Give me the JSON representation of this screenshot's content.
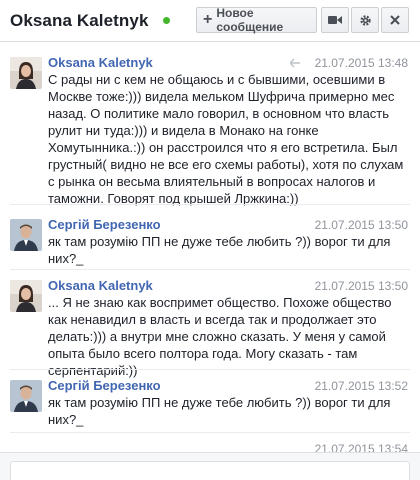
{
  "header": {
    "title": "Oksana Kaletnyk",
    "status": "online",
    "new_message_label": "Новое сообщение",
    "icons": [
      "plus-icon",
      "video-camera-icon",
      "gear-icon",
      "close-icon"
    ]
  },
  "colors": {
    "name_link": "#4267b2",
    "online": "#42b72a",
    "timestamp": "#90949c"
  },
  "messages": [
    {
      "sender": "Oksana Kaletnyk",
      "time": "21.07.2015 13:48",
      "text": "С рады ни с кем не общаюсь и с бывшими, осевшими в Москве тоже:))) видела мельком Шуфрича примерно мес назад. О политике мало говорил, в основном что власть рулит ни туда:))) и видела в Монако на гонке Хомутынника.:)) он расстроился что я его встретила. Был грустный( видно не все его схемы работы), хотя по слухам с рынка он весьма влиятельный в вопросах налогов и таможни. Говорят под крышей Лржкина:))"
    },
    {
      "sender": "Сергій Березенко",
      "time": "21.07.2015 13:50",
      "text": "як там розумію ПП не дуже тебе любить ?)) ворог ти для них?_"
    },
    {
      "sender": "Oksana Kaletnyk",
      "time": "21.07.2015 13:50",
      "text": "... Я не знаю как воспримет общество. Похоже общество как ненавидил в власть и всегда так и продолжает это делать:))) а внутри мне сложно сказать. У меня у самой опыта было всего полтора года. Могу сказать - там серпентарий:))"
    },
    {
      "sender": "Сергій Березенко",
      "time": "21.07.2015 13:52",
      "text": "як там розумію ПП не дуже тебе любить ?)) ворог ти для них?_"
    },
    {
      "sender": "",
      "time": "21.07.2015 13:54",
      "text": ""
    }
  ]
}
